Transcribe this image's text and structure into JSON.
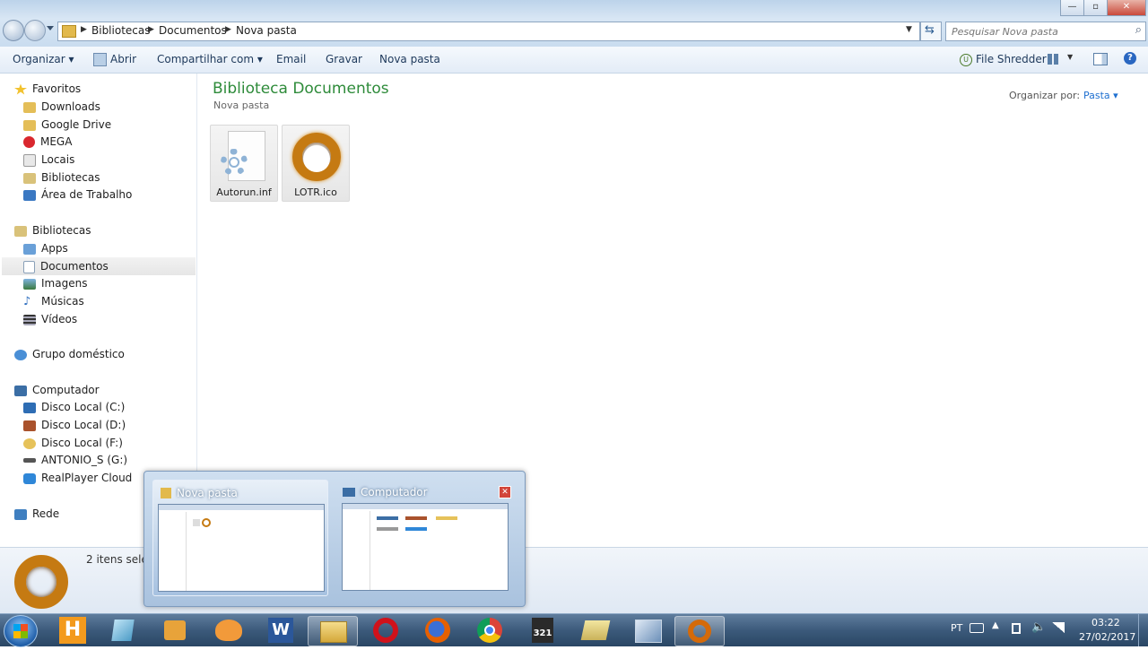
{
  "window": {
    "controls": {
      "minimize": "—",
      "maximize": "▫",
      "close": "✕"
    }
  },
  "address_bar": {
    "crumbs": [
      "Bibliotecas",
      "Documentos",
      "Nova pasta"
    ],
    "search_placeholder": "Pesquisar Nova pasta"
  },
  "toolbar": {
    "organize": "Organizar",
    "open": "Abrir",
    "share": "Compartilhar com",
    "email": "Email",
    "burn": "Gravar",
    "new_folder": "Nova pasta",
    "file_shredder": "File Shredder"
  },
  "sidebar": {
    "favorites": {
      "label": "Favoritos",
      "items": [
        "Downloads",
        "Google Drive",
        "MEGA",
        "Locais",
        "Bibliotecas",
        "Área de Trabalho"
      ]
    },
    "libraries": {
      "label": "Bibliotecas",
      "items": [
        "Apps",
        "Documentos",
        "Imagens",
        "Músicas",
        "Vídeos"
      ]
    },
    "homegroup": "Grupo doméstico",
    "computer": {
      "label": "Computador",
      "items": [
        "Disco Local (C:)",
        "Disco Local (D:)",
        "Disco Local (F:)",
        "ANTONIO_S (G:)",
        "RealPlayer Cloud"
      ]
    },
    "network": "Rede"
  },
  "main": {
    "title": "Biblioteca Documentos",
    "subtitle": "Nova pasta",
    "arrange_label": "Organizar por:",
    "arrange_value": "Pasta",
    "files": [
      {
        "name": "Autorun.inf",
        "icon": "settings-file-icon"
      },
      {
        "name": "LOTR.ico",
        "icon": "ring-icon"
      }
    ]
  },
  "details_pane": {
    "text": "2 itens selec"
  },
  "thumbnails": [
    {
      "title": "Nova pasta",
      "active": true
    },
    {
      "title": "Computador",
      "active": false
    }
  ],
  "taskbar": {
    "apps": [
      "start",
      "h-app",
      "notepad",
      "media-player",
      "music-app",
      "word",
      "explorer",
      "opera",
      "firefox",
      "chrome",
      "321-player",
      "folder",
      "excel-like",
      "ring-app"
    ],
    "language": "PT",
    "time": "03:22",
    "date": "27/02/2017"
  },
  "colors": {
    "title_green": "#2e8b3a",
    "toolbar_text": "#1e395b",
    "link_blue": "#1e6fd0"
  }
}
